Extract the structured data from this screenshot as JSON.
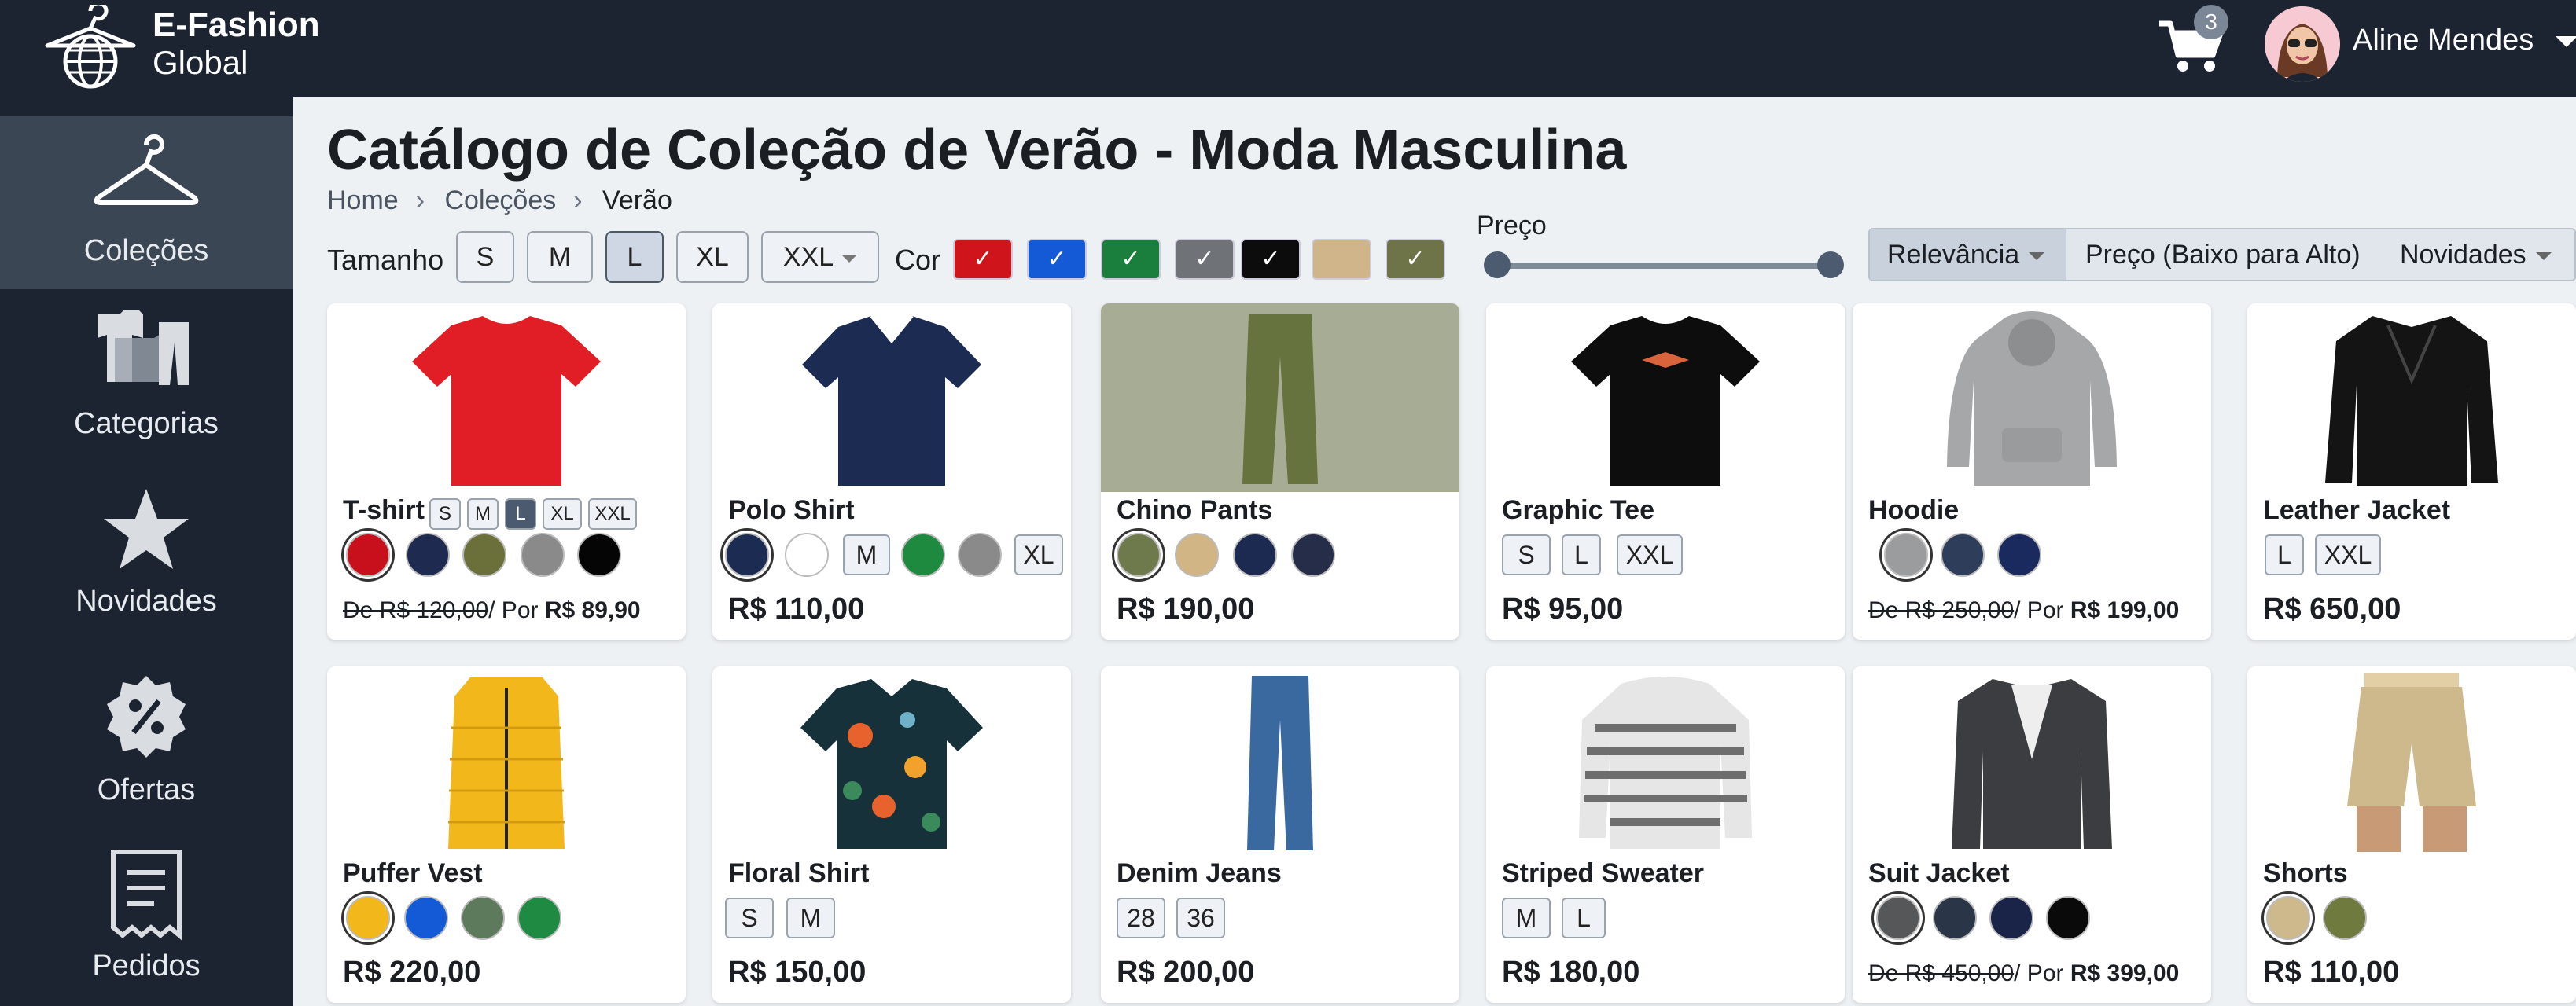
{
  "brand": {
    "line1": "E-Fashion",
    "line2": "Global"
  },
  "header": {
    "cart_count": "3",
    "user_name": "Aline Mendes"
  },
  "sidebar": {
    "items": [
      {
        "label": "Coleções",
        "icon": "hanger-icon"
      },
      {
        "label": "Categorias",
        "icon": "clothes-icon"
      },
      {
        "label": "Novidades",
        "icon": "star-icon"
      },
      {
        "label": "Ofertas",
        "icon": "percent-badge-icon"
      },
      {
        "label": "Pedidos",
        "icon": "receipt-icon"
      }
    ]
  },
  "page": {
    "title": "Catálogo de Coleção de Verão - Moda Masculina"
  },
  "breadcrumb": [
    "Home",
    "Coleções",
    "Verão"
  ],
  "filters": {
    "size_label": "Tamanho",
    "sizes": [
      "S",
      "M",
      "L",
      "XL",
      "XXL"
    ],
    "selected_size": "L",
    "color_label": "Cor",
    "colors": [
      "#d0141c",
      "#1459d6",
      "#1a7f3c",
      "#6f7378",
      "#0c0c0c",
      "#d1b58a",
      "#6e7447"
    ],
    "price_label": "Preço",
    "price_range": [
      0,
      1
    ]
  },
  "sort": {
    "options": [
      "Relevância",
      "Preço (Baixo para Alto)",
      "Novidades"
    ],
    "selected": "Relevância"
  },
  "products": [
    {
      "name": "T-shirt",
      "sizes": [
        "S",
        "M",
        "L",
        "XL",
        "XXL"
      ],
      "selected_size": "L",
      "colors": [
        "#c8101d",
        "#1e2a4f",
        "#6b6f3a",
        "#8a8a8a",
        "#050505"
      ],
      "selected_color": 0,
      "price_old": "De R$ 120,00",
      "price_new": "R$ 89,90",
      "price_sep": "/ Por"
    },
    {
      "name": "Polo Shirt",
      "colors": [
        "#1b2b52",
        "#ffffff"
      ],
      "sizes": [
        "M"
      ],
      "colors2": [
        "#1d8a3f",
        "#8a8a8a"
      ],
      "sizes2": [
        "XL"
      ],
      "selected_color": 0,
      "price": "R$ 110,00"
    },
    {
      "name": "Chino Pants",
      "colors": [
        "#6f7a4c",
        "#d1b584",
        "#1c2a52",
        "#262d48"
      ],
      "selected_color": 0,
      "price": "R$ 190,00"
    },
    {
      "name": "Graphic Tee",
      "sizes": [
        "S",
        "L",
        "XXL"
      ],
      "price": "R$ 95,00"
    },
    {
      "name": "Hoodie",
      "colors": [
        "#9b9c9e",
        "#2e3d5a",
        "#1a2a5e"
      ],
      "selected_color": 0,
      "price_old": "De R$ 250,00",
      "price_new": "R$ 199,00",
      "price_sep": "/ Por"
    },
    {
      "name": "Leather Jacket",
      "sizes": [
        "L",
        "XXL"
      ],
      "price": "R$ 650,00"
    },
    {
      "name": "Puffer Vest",
      "colors": [
        "#f2b71b",
        "#1459d6",
        "#5e7a5c",
        "#1e8a42"
      ],
      "selected_color": 0,
      "price": "R$ 220,00"
    },
    {
      "name": "Floral Shirt",
      "sizes": [
        "S",
        "M"
      ],
      "price": "R$ 150,00"
    },
    {
      "name": "Denim Jeans",
      "sizes": [
        "28",
        "36"
      ],
      "price": "R$ 200,00"
    },
    {
      "name": "Striped Sweater",
      "sizes": [
        "M",
        "L"
      ],
      "price": "R$ 180,00"
    },
    {
      "name": "Suit Jacket",
      "colors": [
        "#555759",
        "#2a3548",
        "#192448",
        "#0a0a0a"
      ],
      "selected_color": 0,
      "price_old": "De R$ 450,00",
      "price_new": "R$ 399,00",
      "price_sep": "/ Por"
    },
    {
      "name": "Shorts",
      "colors": [
        "#cdb98c",
        "#6f7a3f"
      ],
      "selected_color": 0,
      "price": "R$ 110,00"
    }
  ]
}
